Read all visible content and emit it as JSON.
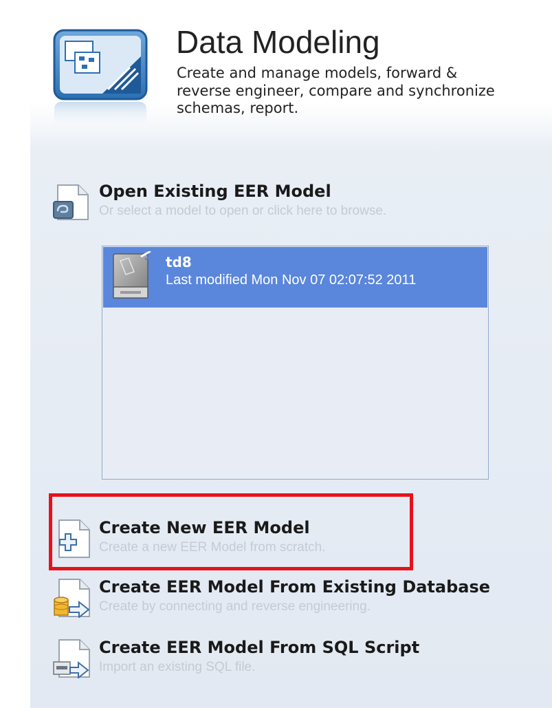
{
  "header": {
    "title": "Data Modeling",
    "subtitle": "Create and manage models, forward & reverse engineer, compare and synchronize schemas, report.",
    "icon": "data-modeling-icon"
  },
  "open_model": {
    "label": "Open Existing EER Model",
    "description": "Or select a model to open or click here to browse.",
    "icon": "open-folder-icon"
  },
  "model_list": {
    "items": [
      {
        "name": "td8",
        "modified": "Last modified Mon Nov 07 02:07:52 2011",
        "selected": true
      }
    ]
  },
  "actions": [
    {
      "label": "Create New EER Model",
      "description": "Create a new EER Model from scratch.",
      "icon": "new-document-plus-icon",
      "highlighted": true
    },
    {
      "label": "Create EER Model From Existing Database",
      "description": "Create by connecting and reverse engineering.",
      "icon": "database-arrow-icon"
    },
    {
      "label": "Create EER Model From SQL Script",
      "description": "Import an existing SQL file.",
      "icon": "sql-script-arrow-icon"
    }
  ],
  "colors": {
    "selection": "#5a86dc",
    "highlight_border": "#e8111b",
    "description_text": "#c6cad2"
  }
}
